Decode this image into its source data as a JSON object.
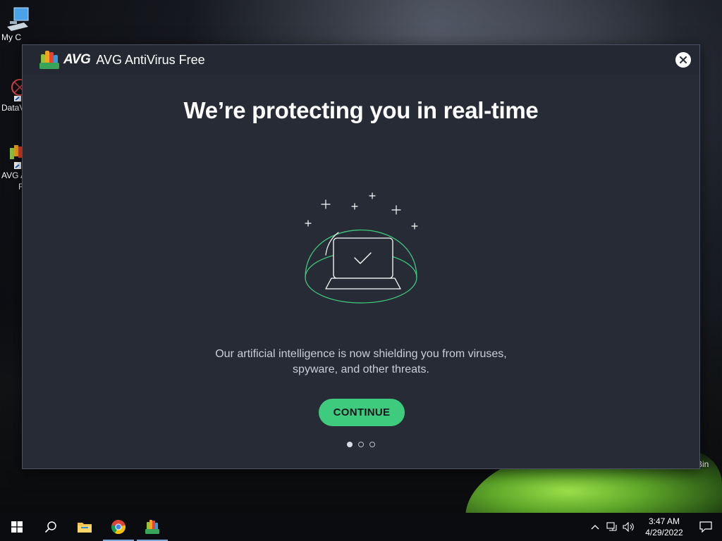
{
  "desktop": {
    "icons": [
      {
        "label": "My C",
        "icon": "computer-icon"
      },
      {
        "label": "DataV",
        "icon": "dataviz-icon"
      },
      {
        "label": "AVG A",
        "label2": "F",
        "icon": "avg-icon"
      }
    ],
    "recycle_bin_label": "Bin"
  },
  "dialog": {
    "brand": "AVG",
    "title": "AVG AntiVirus Free",
    "heading": "We’re protecting you in real-time",
    "description_line1": "Our artificial intelligence is now shielding you from viruses,",
    "description_line2": "spyware, and other threats.",
    "continue_label": "CONTINUE",
    "pager": {
      "total": 3,
      "current": 1
    }
  },
  "colors": {
    "dialog_bg": "#262b36",
    "accent_green": "#3fcb7d",
    "illustration_stroke": "#3fcb7d"
  },
  "taskbar": {
    "items": [
      "start-icon",
      "search-icon",
      "file-explorer-icon",
      "chrome-icon",
      "avg-icon"
    ],
    "time": "3:47 AM",
    "date": "4/29/2022"
  }
}
